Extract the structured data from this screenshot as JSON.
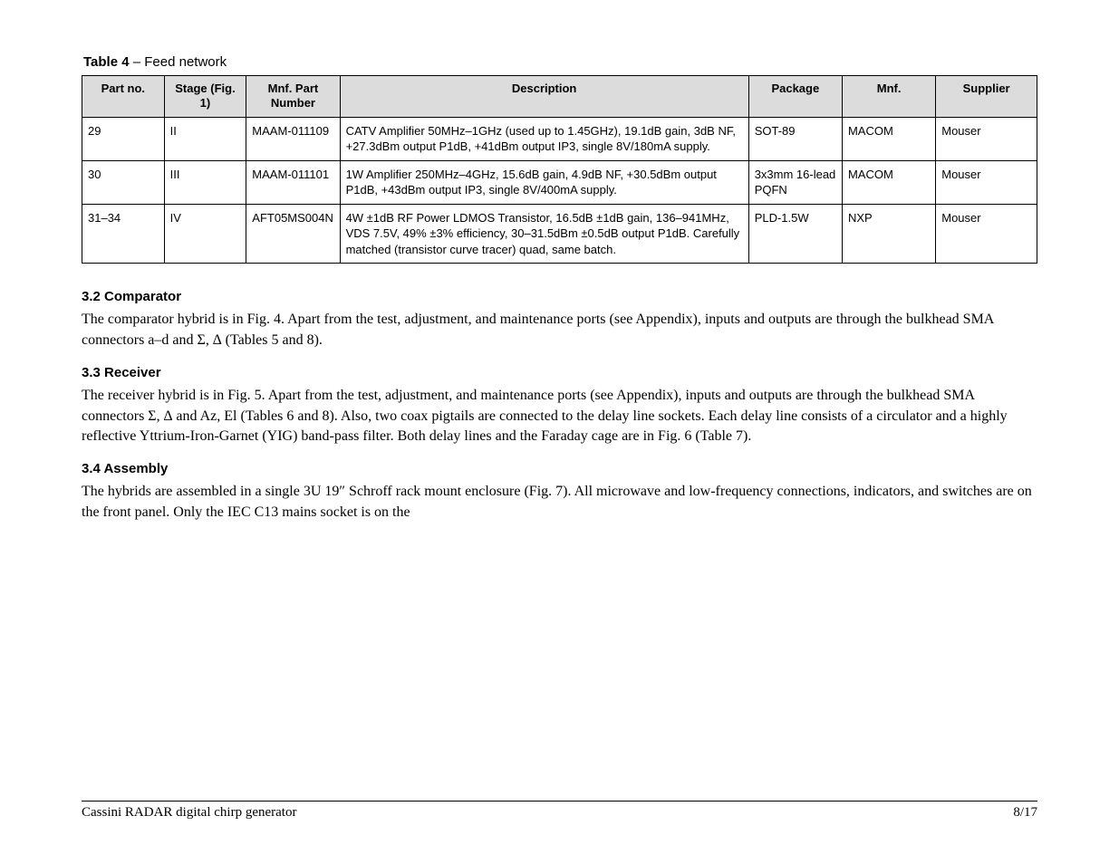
{
  "table": {
    "number": "Table 4",
    "title_rest": " – Feed network",
    "headers": [
      "Part no.",
      "Stage (Fig. 1)",
      "Mnf. Part Number",
      "Description",
      "Package",
      "Mnf.",
      "Supplier"
    ],
    "rows": [
      {
        "part": "29",
        "stage": "II",
        "mpn": "MAAM-011109",
        "desc": "CATV Amplifier 50MHz–1GHz (used up to 1.45GHz), 19.1dB gain, 3dB NF, +27.3dBm output P1dB, +41dBm output IP3, single 8V/180mA supply.",
        "pkg": "SOT-89",
        "mnf": "MACOM",
        "sup": "Mouser"
      },
      {
        "part": "30",
        "stage": "III",
        "mpn": "MAAM-011101",
        "desc": "1W Amplifier 250MHz–4GHz, 15.6dB gain, 4.9dB NF, +30.5dBm output P1dB, +43dBm output IP3, single 8V/400mA supply.",
        "pkg": "3x3mm 16-lead PQFN",
        "mnf": "MACOM",
        "sup": "Mouser"
      },
      {
        "part": "31–34",
        "stage": "IV",
        "mpn": "AFT05MS004N",
        "desc": "4W ±1dB RF Power LDMOS Transistor, 16.5dB ±1dB gain, 136–941MHz, VDS 7.5V, 49% ±3% efficiency, 30–31.5dBm ±0.5dB output P1dB. Carefully matched (transistor curve tracer) quad, same batch.",
        "pkg": "PLD-1.5W",
        "mnf": "NXP",
        "sup": "Mouser"
      }
    ]
  },
  "sections": [
    {
      "heading": "3.2  Comparator",
      "paragraph": "The comparator hybrid is in Fig. 4. Apart from the test, adjustment, and maintenance ports (see Appendix), inputs and outputs are through the bulkhead SMA connectors a–d and Σ, ∆ (Tables 5 and 8)."
    },
    {
      "heading": "3.3  Receiver",
      "paragraph": "The receiver hybrid is in Fig. 5. Apart from the test, adjustment, and maintenance ports (see Appendix), inputs and outputs are through the bulkhead SMA connectors Σ, ∆ and Az, El (Tables 6 and 8). Also, two coax pigtails are connected to the delay line sockets. Each delay line consists of a circulator and a highly reflective Yttrium-Iron-Garnet (YIG) band-pass filter. Both delay lines and the Faraday cage are in Fig. 6 (Table 7)."
    },
    {
      "heading": "3.4  Assembly",
      "paragraph": "The hybrids are assembled in a single 3U 19″ Schroff rack mount enclosure (Fig. 7). All microwave and low-frequency connections, indicators, and switches are on the front panel. Only the IEC C13 mains socket is on the"
    }
  ],
  "footer": {
    "left": "Cassini RADAR digital chirp generator",
    "right": "8/17"
  }
}
